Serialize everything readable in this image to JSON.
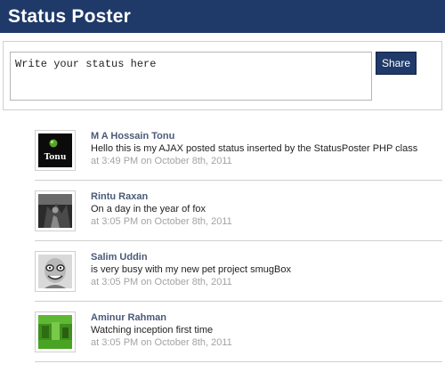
{
  "header": {
    "title": "Status Poster"
  },
  "composer": {
    "placeholder": "Write your status here",
    "share_label": "Share"
  },
  "posts": [
    {
      "author": "M A Hossain Tonu",
      "text": "Hello this is my AJAX posted status inserted by the StatusPoster PHP class",
      "time": "at 3:49 PM on October 8th, 2011",
      "avatar_label": "Tonu"
    },
    {
      "author": "Rintu Raxan",
      "text": "On a day in the year of fox",
      "time": "at 3:05 PM on October 8th, 2011"
    },
    {
      "author": "Salim Uddin",
      "text": "is very busy with my new pet project smugBox",
      "time": "at 3:05 PM on October 8th, 2011"
    },
    {
      "author": "Aminur Rahman",
      "text": "Watching inception first time",
      "time": "at 3:05 PM on October 8th, 2011"
    }
  ]
}
